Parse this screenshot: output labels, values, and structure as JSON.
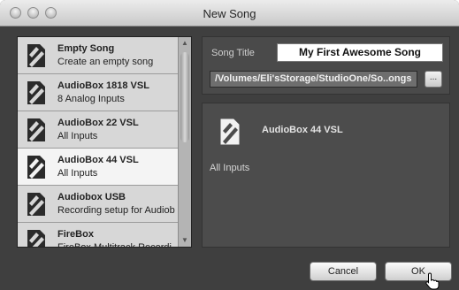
{
  "window": {
    "title": "New Song"
  },
  "templates": [
    {
      "name": "Empty Song",
      "desc": "Create an empty song"
    },
    {
      "name": "AudioBox 1818 VSL",
      "desc": "8 Analog Inputs"
    },
    {
      "name": "AudioBox 22 VSL",
      "desc": "All Inputs"
    },
    {
      "name": "AudioBox 44 VSL",
      "desc": "All Inputs",
      "selected": true
    },
    {
      "name": "Audiobox USB",
      "desc": "Recording setup for Audiob"
    },
    {
      "name": "FireBox",
      "desc": "FireBox Multitrack Recordi"
    }
  ],
  "form": {
    "song_title_label": "Song Title",
    "song_title_value": "My First Awesome Song",
    "path_value": "/Volumes/Eli'sStorage/StudioOne/So..ongs",
    "browse_label": "..."
  },
  "detail": {
    "name": "AudioBox 44 VSL",
    "desc": "All Inputs"
  },
  "buttons": {
    "cancel": "Cancel",
    "ok": "OK"
  },
  "colors": {
    "selected_item_bg": "#f4f4f4",
    "panel_bg": "#4c4c4c",
    "window_bg": "#3f3f3f"
  },
  "icons": {
    "template": "studio-one-template-icon",
    "cursor": "hand-pointer-icon"
  }
}
